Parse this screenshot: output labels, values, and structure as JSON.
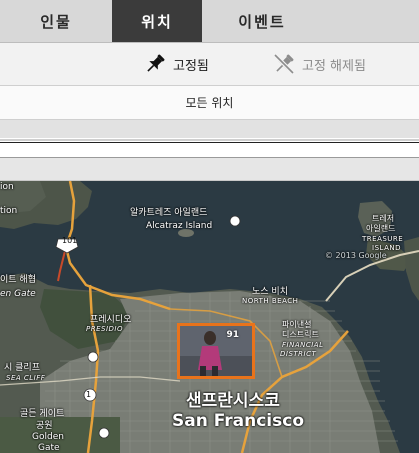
{
  "tabs": [
    {
      "label": "인물"
    },
    {
      "label": "위치"
    },
    {
      "label": "이벤트"
    }
  ],
  "pin_filter": {
    "pinned_label": "고정됨",
    "unpinned_label": "고정 해제됨"
  },
  "location_filter": {
    "label": "모든 위치"
  },
  "map": {
    "labels": {
      "alcatraz_ko": "알카트레즈 아일랜드",
      "alcatraz_en": "Alcatraz Island",
      "treasure_ko_1": "트레저",
      "treasure_ko_2": "아일랜드",
      "treasure_en_1": "TREASURE",
      "treasure_en_2": "ISLAND",
      "gg_strait_ko": "이트 해협",
      "gg_strait_en": "en Gate",
      "ion": "ion",
      "tion": "tion",
      "presidio_ko": "프레시디오",
      "presidio_en": "PRESIDIO",
      "north_beach_ko": "노스 비치",
      "north_beach_en": "NORTH BEACH",
      "financial_ko_1": "파이낸셜",
      "financial_ko_2": "디스트릭트",
      "financial_en_1": "FINANCIAL",
      "financial_en_2": "DISTRICT",
      "sea_cliff_ko": "시 클리프",
      "sea_cliff_en": "SEA CLIFF",
      "ggpark_ko_1": "골든 게이트",
      "ggpark_ko_2": "공원",
      "ggpark_en_1": "Golden",
      "ggpark_en_2": "Gate",
      "sf_ko": "샌프란시스코",
      "sf_en": "San Francisco",
      "hwy_101": "101",
      "hwy_1": "1",
      "watermark": "© 2013 Google"
    },
    "photo_cluster": {
      "count": "91"
    },
    "colors": {
      "water": "#2b3a43",
      "land": "#4a5248",
      "urban": "#7c8078",
      "highway": "#e6a23c",
      "cluster_border": "#e8731b"
    }
  }
}
